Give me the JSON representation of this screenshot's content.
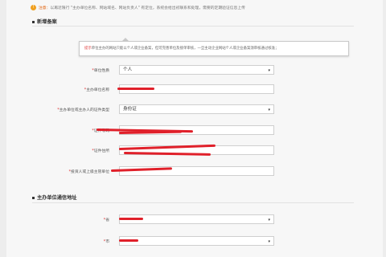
{
  "notice": {
    "prefix": "注意：",
    "text": "以再近限行 \"主办单位名称、网站域名、网站负责人\" 有定位，系统会给出初联系和处理，需要的定期验证信息上传"
  },
  "sections": {
    "record_title": "新增备案",
    "address_title": "主办单位通信地址"
  },
  "hint": {
    "prefix": "提示",
    "text": "单位主办的网站只能以个人或企业备案，但可完善单位及接单审核，一旦主动企业网站个人或企业备案须审核通过核准；"
  },
  "form": {
    "unit_nature": {
      "label": "单位性质",
      "value": "个人"
    },
    "unit_name": {
      "label": "主办单位名称",
      "value": ""
    },
    "id_type": {
      "label": "主办单位或主办人的证件类型",
      "value": "身份证"
    },
    "id_number": {
      "label": "证件号码",
      "value": ""
    },
    "id_address": {
      "label": "证件住所",
      "value": ""
    },
    "upload_person": {
      "label": "投资人或上级主管单位",
      "value": ""
    },
    "province": {
      "label": "省",
      "value": ""
    },
    "city": {
      "label": "市",
      "value": ""
    }
  },
  "colors": {
    "scribble": "#e0202a",
    "notice_accent": "#e05a00",
    "background": "#f7f7f7"
  }
}
